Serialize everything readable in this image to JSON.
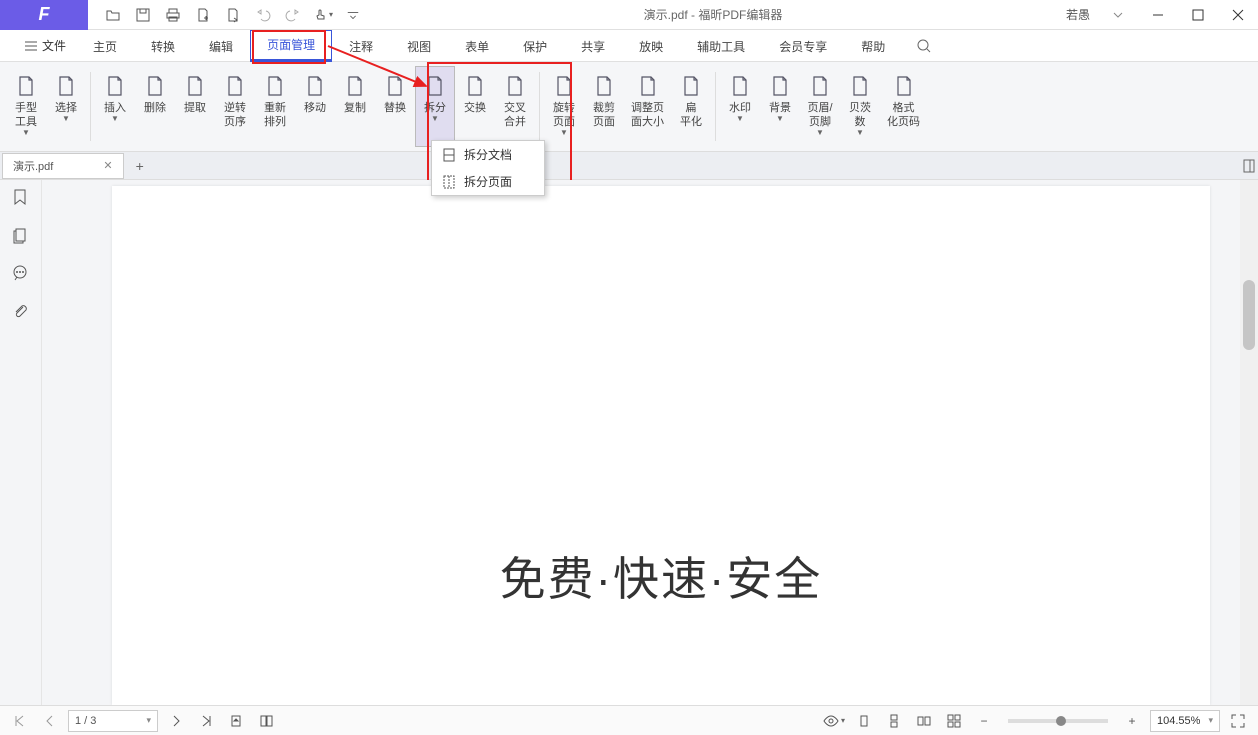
{
  "title": "演示.pdf - 福昕PDF编辑器",
  "user": "若愚",
  "menu_file": "文件",
  "menus": [
    "主页",
    "转换",
    "编辑",
    "页面管理",
    "注释",
    "视图",
    "表单",
    "保护",
    "共享",
    "放映",
    "辅助工具",
    "会员专享",
    "帮助"
  ],
  "active_menu_index": 3,
  "ribbon": [
    {
      "l": "手型\n工具",
      "d": true
    },
    {
      "l": "选择",
      "d": true
    },
    {
      "sep": true
    },
    {
      "l": "插入",
      "d": true
    },
    {
      "l": "删除"
    },
    {
      "l": "提取"
    },
    {
      "l": "逆转\n页序"
    },
    {
      "l": "重新\n排列"
    },
    {
      "l": "移动"
    },
    {
      "l": "复制"
    },
    {
      "l": "替换"
    },
    {
      "l": "拆分",
      "d": true,
      "hl": true
    },
    {
      "l": "交换"
    },
    {
      "l": "交叉\n合并"
    },
    {
      "sep": true
    },
    {
      "l": "旋转\n页面",
      "d": true
    },
    {
      "l": "裁剪\n页面"
    },
    {
      "l": "调整页\n面大小"
    },
    {
      "l": "扁\n平化"
    },
    {
      "sep": true
    },
    {
      "l": "水印",
      "d": true
    },
    {
      "l": "背景",
      "d": true
    },
    {
      "l": "页眉/\n页脚",
      "d": true
    },
    {
      "l": "贝茨\n数",
      "d": true
    },
    {
      "l": "格式\n化页码"
    }
  ],
  "dropdown": [
    "拆分文档",
    "拆分页面"
  ],
  "doc_tab": "演示.pdf",
  "page_text": "免费·快速·安全",
  "status": {
    "page": "1 / 3",
    "zoom": "104.55%"
  }
}
